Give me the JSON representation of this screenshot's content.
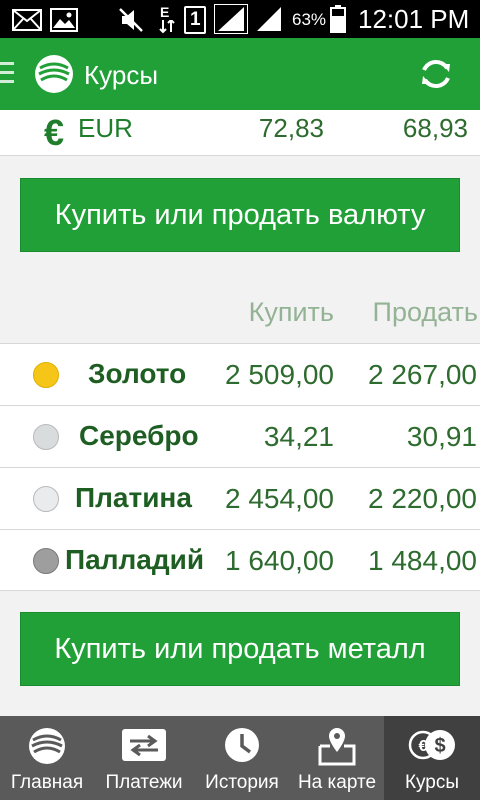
{
  "status_bar": {
    "battery_percent": "63%",
    "time": "12:01 PM",
    "sim_badge": "1",
    "data_badge": "E"
  },
  "app_bar": {
    "title": "Курсы"
  },
  "currency_row": {
    "symbol": "€",
    "code": "EUR",
    "buy": "72,83",
    "sell": "68,93"
  },
  "buttons": {
    "currency_label": "Купить или продать валюту",
    "metal_label": "Купить или продать металл"
  },
  "metals_table": {
    "headers": {
      "buy": "Купить",
      "sell": "Продать"
    },
    "rows": [
      {
        "name": "Золото",
        "buy": "2 509,00",
        "sell": "2 267,00",
        "color": "#f5c518"
      },
      {
        "name": "Серебро",
        "buy": "34,21",
        "sell": "30,91",
        "color": "#d9dcdd"
      },
      {
        "name": "Платина",
        "buy": "2 454,00",
        "sell": "2 220,00",
        "color": "#e9ebec"
      },
      {
        "name": "Палладий",
        "buy": "1 640,00",
        "sell": "1 484,00",
        "color": "#9e9e9e"
      }
    ]
  },
  "bottom_nav": {
    "items": [
      {
        "label": "Главная",
        "icon": "sber-logo-icon"
      },
      {
        "label": "Платежи",
        "icon": "payments-icon"
      },
      {
        "label": "История",
        "icon": "clock-icon"
      },
      {
        "label": "На карте",
        "icon": "map-icon"
      },
      {
        "label": "Курсы",
        "icon": "currency-icon",
        "active": true
      }
    ]
  },
  "colors": {
    "brand_green": "#21a038",
    "text_green": "#2d6b2e",
    "header_green_muted": "#93b394",
    "nav_bg": "#5a5a5a",
    "nav_active_bg": "#404040"
  }
}
